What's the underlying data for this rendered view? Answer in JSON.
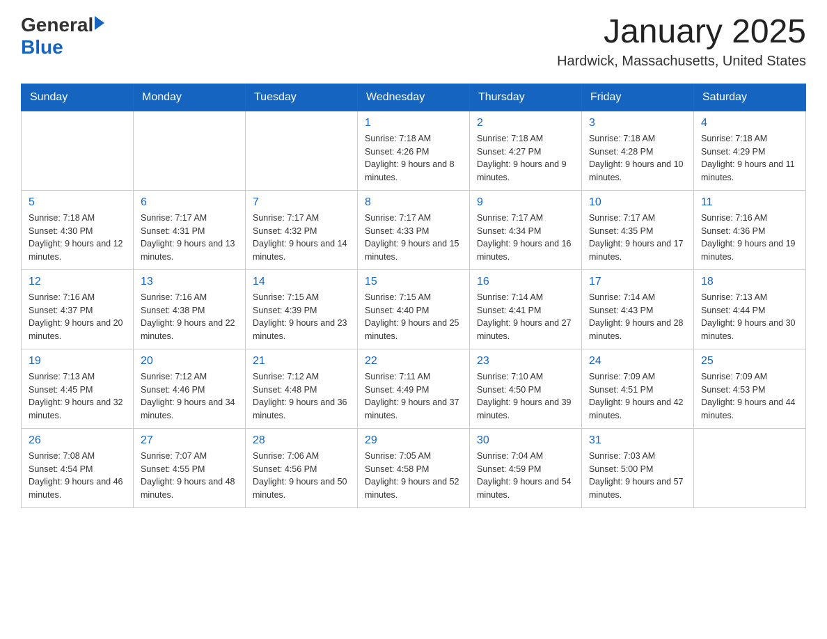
{
  "header": {
    "logo_general": "General",
    "logo_blue": "Blue",
    "month": "January 2025",
    "location": "Hardwick, Massachusetts, United States"
  },
  "days_of_week": [
    "Sunday",
    "Monday",
    "Tuesday",
    "Wednesday",
    "Thursday",
    "Friday",
    "Saturday"
  ],
  "weeks": [
    [
      {
        "num": "",
        "info": ""
      },
      {
        "num": "",
        "info": ""
      },
      {
        "num": "",
        "info": ""
      },
      {
        "num": "1",
        "info": "Sunrise: 7:18 AM\nSunset: 4:26 PM\nDaylight: 9 hours and 8 minutes."
      },
      {
        "num": "2",
        "info": "Sunrise: 7:18 AM\nSunset: 4:27 PM\nDaylight: 9 hours and 9 minutes."
      },
      {
        "num": "3",
        "info": "Sunrise: 7:18 AM\nSunset: 4:28 PM\nDaylight: 9 hours and 10 minutes."
      },
      {
        "num": "4",
        "info": "Sunrise: 7:18 AM\nSunset: 4:29 PM\nDaylight: 9 hours and 11 minutes."
      }
    ],
    [
      {
        "num": "5",
        "info": "Sunrise: 7:18 AM\nSunset: 4:30 PM\nDaylight: 9 hours and 12 minutes."
      },
      {
        "num": "6",
        "info": "Sunrise: 7:17 AM\nSunset: 4:31 PM\nDaylight: 9 hours and 13 minutes."
      },
      {
        "num": "7",
        "info": "Sunrise: 7:17 AM\nSunset: 4:32 PM\nDaylight: 9 hours and 14 minutes."
      },
      {
        "num": "8",
        "info": "Sunrise: 7:17 AM\nSunset: 4:33 PM\nDaylight: 9 hours and 15 minutes."
      },
      {
        "num": "9",
        "info": "Sunrise: 7:17 AM\nSunset: 4:34 PM\nDaylight: 9 hours and 16 minutes."
      },
      {
        "num": "10",
        "info": "Sunrise: 7:17 AM\nSunset: 4:35 PM\nDaylight: 9 hours and 17 minutes."
      },
      {
        "num": "11",
        "info": "Sunrise: 7:16 AM\nSunset: 4:36 PM\nDaylight: 9 hours and 19 minutes."
      }
    ],
    [
      {
        "num": "12",
        "info": "Sunrise: 7:16 AM\nSunset: 4:37 PM\nDaylight: 9 hours and 20 minutes."
      },
      {
        "num": "13",
        "info": "Sunrise: 7:16 AM\nSunset: 4:38 PM\nDaylight: 9 hours and 22 minutes."
      },
      {
        "num": "14",
        "info": "Sunrise: 7:15 AM\nSunset: 4:39 PM\nDaylight: 9 hours and 23 minutes."
      },
      {
        "num": "15",
        "info": "Sunrise: 7:15 AM\nSunset: 4:40 PM\nDaylight: 9 hours and 25 minutes."
      },
      {
        "num": "16",
        "info": "Sunrise: 7:14 AM\nSunset: 4:41 PM\nDaylight: 9 hours and 27 minutes."
      },
      {
        "num": "17",
        "info": "Sunrise: 7:14 AM\nSunset: 4:43 PM\nDaylight: 9 hours and 28 minutes."
      },
      {
        "num": "18",
        "info": "Sunrise: 7:13 AM\nSunset: 4:44 PM\nDaylight: 9 hours and 30 minutes."
      }
    ],
    [
      {
        "num": "19",
        "info": "Sunrise: 7:13 AM\nSunset: 4:45 PM\nDaylight: 9 hours and 32 minutes."
      },
      {
        "num": "20",
        "info": "Sunrise: 7:12 AM\nSunset: 4:46 PM\nDaylight: 9 hours and 34 minutes."
      },
      {
        "num": "21",
        "info": "Sunrise: 7:12 AM\nSunset: 4:48 PM\nDaylight: 9 hours and 36 minutes."
      },
      {
        "num": "22",
        "info": "Sunrise: 7:11 AM\nSunset: 4:49 PM\nDaylight: 9 hours and 37 minutes."
      },
      {
        "num": "23",
        "info": "Sunrise: 7:10 AM\nSunset: 4:50 PM\nDaylight: 9 hours and 39 minutes."
      },
      {
        "num": "24",
        "info": "Sunrise: 7:09 AM\nSunset: 4:51 PM\nDaylight: 9 hours and 42 minutes."
      },
      {
        "num": "25",
        "info": "Sunrise: 7:09 AM\nSunset: 4:53 PM\nDaylight: 9 hours and 44 minutes."
      }
    ],
    [
      {
        "num": "26",
        "info": "Sunrise: 7:08 AM\nSunset: 4:54 PM\nDaylight: 9 hours and 46 minutes."
      },
      {
        "num": "27",
        "info": "Sunrise: 7:07 AM\nSunset: 4:55 PM\nDaylight: 9 hours and 48 minutes."
      },
      {
        "num": "28",
        "info": "Sunrise: 7:06 AM\nSunset: 4:56 PM\nDaylight: 9 hours and 50 minutes."
      },
      {
        "num": "29",
        "info": "Sunrise: 7:05 AM\nSunset: 4:58 PM\nDaylight: 9 hours and 52 minutes."
      },
      {
        "num": "30",
        "info": "Sunrise: 7:04 AM\nSunset: 4:59 PM\nDaylight: 9 hours and 54 minutes."
      },
      {
        "num": "31",
        "info": "Sunrise: 7:03 AM\nSunset: 5:00 PM\nDaylight: 9 hours and 57 minutes."
      },
      {
        "num": "",
        "info": ""
      }
    ]
  ]
}
